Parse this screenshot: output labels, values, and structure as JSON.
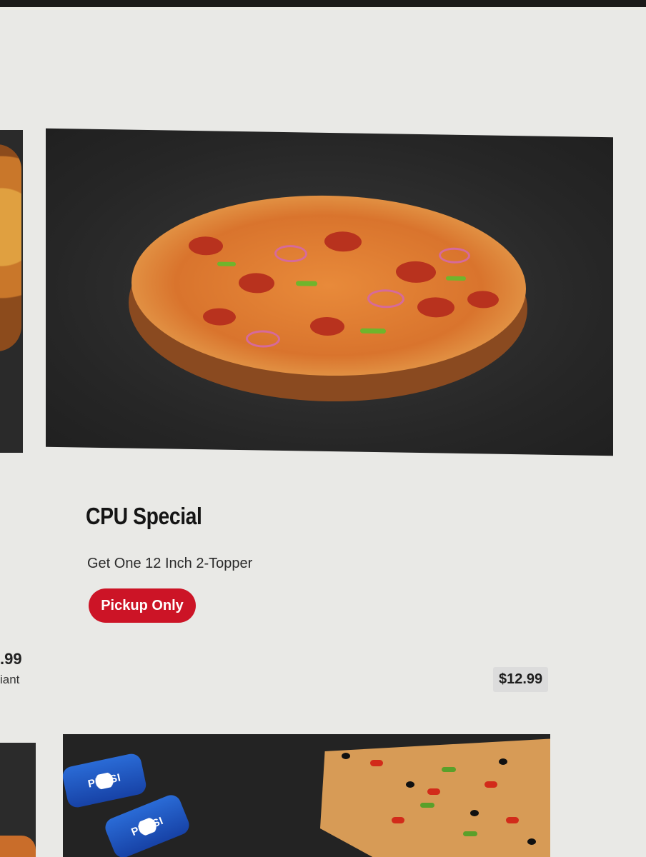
{
  "left_card": {
    "price_partial": ".99",
    "variant_partial": "iant"
  },
  "product": {
    "title": "CPU Special",
    "description": "Get One 12 Inch 2-Topper",
    "badge": "Pickup Only",
    "price": "$12.99",
    "image_icon": "pizza-image"
  },
  "next_card": {
    "image_icon": "pizza-and-pepsi-image",
    "can_label_1": "PEPSI",
    "can_label_2": "PEPSI"
  },
  "colors": {
    "badge_bg": "#cc1426",
    "badge_text": "#ffffff",
    "page_bg": "#e9e9e6"
  }
}
